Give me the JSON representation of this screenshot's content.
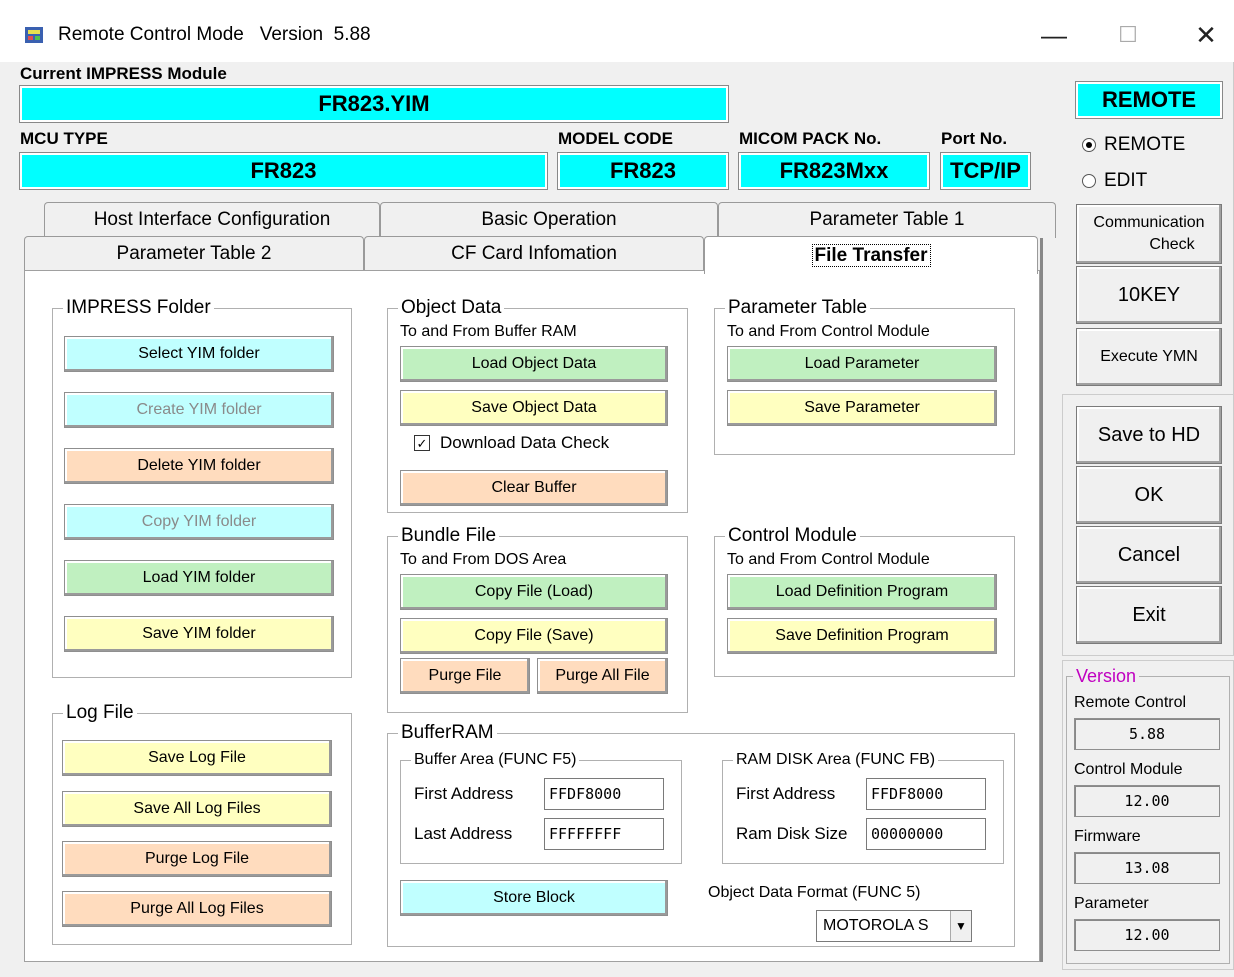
{
  "window": {
    "title": "Remote Control Mode   Version  5.88",
    "minimize": "—",
    "maximize": "☐",
    "close": "✕"
  },
  "header": {
    "impress_module_label": "Current IMPRESS Module",
    "impress_module_value": "FR823.YIM",
    "mcu_type_label": "MCU TYPE",
    "mcu_type_value": "FR823",
    "model_code_label": "MODEL CODE",
    "model_code_value": "FR823",
    "micom_pack_label": "MICOM PACK No.",
    "micom_pack_value": "FR823Mxx",
    "port_label": "Port No.",
    "port_value": "TCP/IP"
  },
  "mode": {
    "indicator": "REMOTE",
    "radio_remote": "REMOTE",
    "radio_edit": "EDIT",
    "selected": "REMOTE"
  },
  "tabs": {
    "row1": [
      "Host Interface Configuration",
      "Basic Operation",
      "Parameter Table 1"
    ],
    "row2": [
      "Parameter Table 2",
      "CF Card Infomation",
      "File Transfer"
    ],
    "active": "File Transfer"
  },
  "impress_folder": {
    "title": "IMPRESS Folder",
    "select": "Select YIM folder",
    "create": "Create YIM folder",
    "delete": "Delete YIM folder",
    "copy": "Copy YIM folder",
    "load": "Load YIM folder",
    "save": "Save YIM folder"
  },
  "log_file": {
    "title": "Log File",
    "save": "Save Log File",
    "save_all": "Save All Log Files",
    "purge": "Purge Log File",
    "purge_all": "Purge All Log Files"
  },
  "object_data": {
    "title": "Object Data",
    "subtitle": "To and From Buffer RAM",
    "load": "Load Object Data",
    "save": "Save Object Data",
    "download_check": "Download Data Check",
    "download_checked": true,
    "clear": "Clear Buffer"
  },
  "parameter_table": {
    "title": "Parameter Table",
    "subtitle": "To and From Control Module",
    "load": "Load Parameter",
    "save": "Save Parameter"
  },
  "bundle_file": {
    "title": "Bundle File",
    "subtitle": "To and From DOS Area",
    "copy_load": "Copy File (Load)",
    "copy_save": "Copy File (Save)",
    "purge": "Purge File",
    "purge_all": "Purge All File"
  },
  "control_module": {
    "title": "Control Module",
    "subtitle": "To and From Control Module",
    "load": "Load Definition Program",
    "save": "Save Definition Program"
  },
  "buffer_ram": {
    "title": "BufferRAM",
    "buffer_area_title": "Buffer Area (FUNC F5)",
    "first_address_label": "First  Address",
    "first_address": "FFDF8000",
    "last_address_label": "Last  Address",
    "last_address": "FFFFFFFF",
    "ram_disk_title": "RAM DISK Area (FUNC FB)",
    "ram_first_label": "First  Address",
    "ram_first": "FFDF8000",
    "ram_size_label": "Ram Disk Size",
    "ram_size": "00000000",
    "store_block": "Store Block",
    "format_label": "Object Data Format (FUNC 5)",
    "format_value": "MOTOROLA S"
  },
  "right_panel": {
    "communication_check_1": "Communication",
    "communication_check_2": "Check",
    "tenkey": "10KEY",
    "execute_ymn": "Execute YMN",
    "save_to_hd": "Save to HD",
    "ok": "OK",
    "cancel": "Cancel",
    "exit": "Exit"
  },
  "version": {
    "title": "Version",
    "remote_control_label": "Remote Control",
    "remote_control": "5.88",
    "control_module_label": "Control Module",
    "control_module": "12.00",
    "firmware_label": "Firmware",
    "firmware": "13.08",
    "parameter_label": "Parameter",
    "parameter": "12.00"
  },
  "colors": {
    "cyan": "#00ffff",
    "green_button": "#c0f0c0",
    "yellow_button": "#ffffc0",
    "orange_button": "#ffdcbe",
    "cyan_button": "#c0ffff",
    "version_title": "#c000c0"
  }
}
